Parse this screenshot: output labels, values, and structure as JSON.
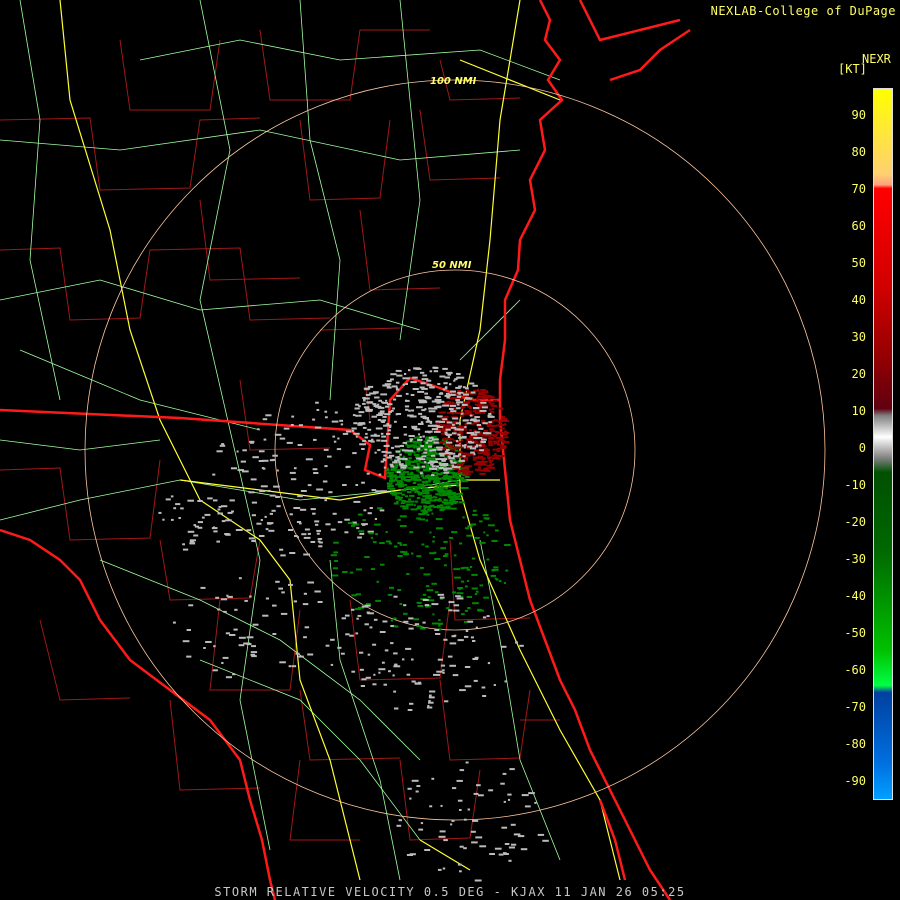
{
  "credit": "NEXLAB-College of DuPage",
  "legend": {
    "title": "NEXR",
    "unit": "[KT]",
    "ticks": [
      "90",
      "80",
      "70",
      "60",
      "50",
      "40",
      "30",
      "20",
      "10",
      "0",
      "-10",
      "-20",
      "-30",
      "-40",
      "-50",
      "-60",
      "-70",
      "-80",
      "-90"
    ]
  },
  "rings": [
    "100 NMI",
    "50 NMI"
  ],
  "footer": "STORM RELATIVE VELOCITY 0.5 DEG - KJAX 11 JAN 26 05:25",
  "colors": {
    "coast": "#ff1a1a",
    "county": "#a01818",
    "highway_major": "#ffff33",
    "highway_minor": "#a0ffa0",
    "ring": "#ffc8a0",
    "inbound": "#008800",
    "outbound": "#990000",
    "near_zero": "#bbbbbb"
  }
}
